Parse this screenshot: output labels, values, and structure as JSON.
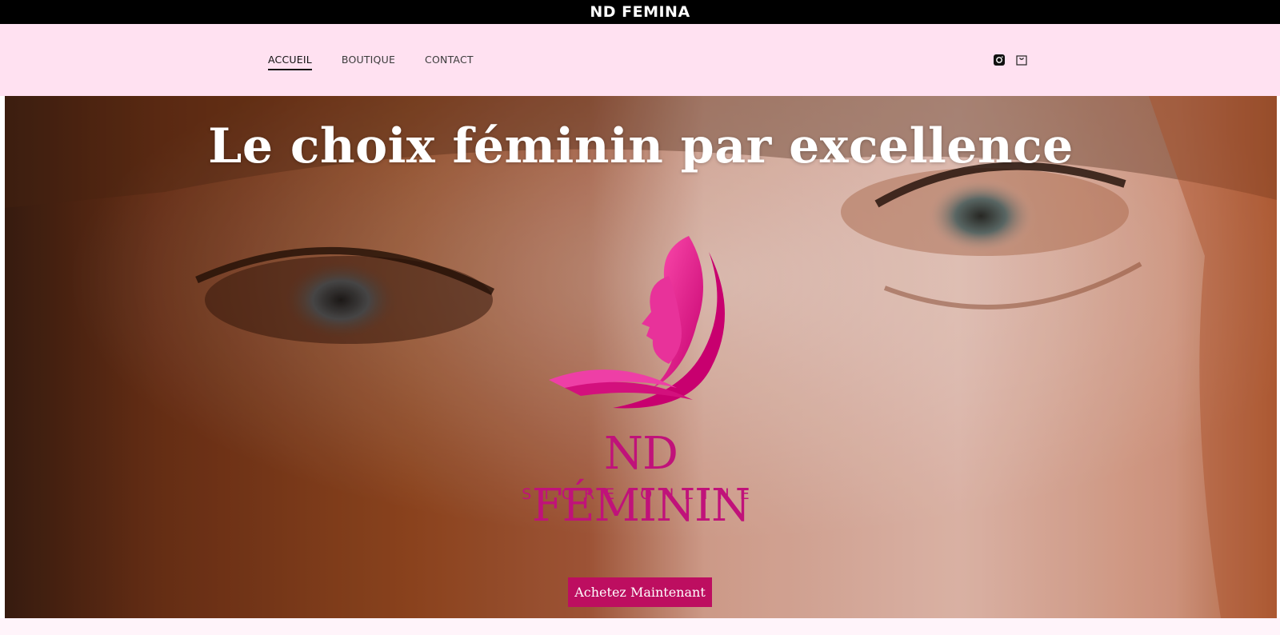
{
  "topbar": {
    "title": "ND FEMINA"
  },
  "nav": {
    "items": [
      {
        "label": "ACCUEIL",
        "active": true
      },
      {
        "label": "BOUTIQUE",
        "active": false
      },
      {
        "label": "CONTACT",
        "active": false
      }
    ]
  },
  "header_icons": [
    "instagram-icon",
    "shopping-bag-icon"
  ],
  "hero": {
    "title": "Le choix féminin par excellence",
    "logo_name": "ND FÉMININ",
    "logo_tagline": "STORE ONLINE",
    "cta_label": "Achetez Maintenant"
  },
  "colors": {
    "topbar_bg": "#000000",
    "header_bg": "#ffe1f1",
    "brand_pink": "#c0127a",
    "cta_bg": "#bd0e60"
  }
}
